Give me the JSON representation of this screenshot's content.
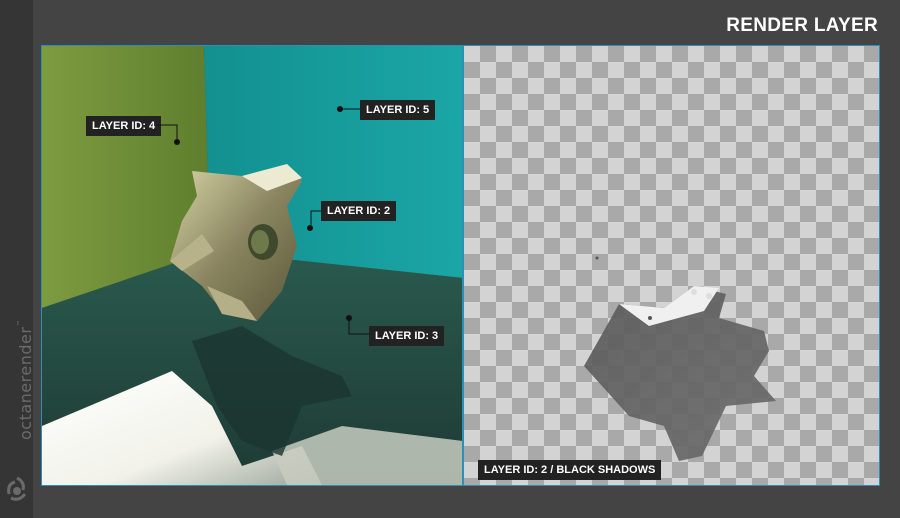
{
  "page": {
    "title": "RENDER LAYER"
  },
  "brand": {
    "name": "octanerender",
    "trademark": "™"
  },
  "layers": {
    "layer4": "LAYER ID: 4",
    "layer5": "LAYER ID: 5",
    "layer2": "LAYER ID: 2",
    "layer3": "LAYER ID: 3",
    "shadow_layer": "LAYER ID: 2 / BLACK SHADOWS"
  },
  "colors": {
    "background": "#444444",
    "sidebar": "#353535",
    "frame_border": "#2d8fb6",
    "label_bg": "#222222",
    "wall_left": "#6f8f3a",
    "wall_right": "#1aa0a0",
    "floor": "#254a40",
    "checker_light": "#d3d3d3",
    "checker_dark": "#a9a9a9"
  },
  "icons": {
    "brand_logo": "octane-logo-icon",
    "alpha_background": "transparency-checkerboard"
  }
}
